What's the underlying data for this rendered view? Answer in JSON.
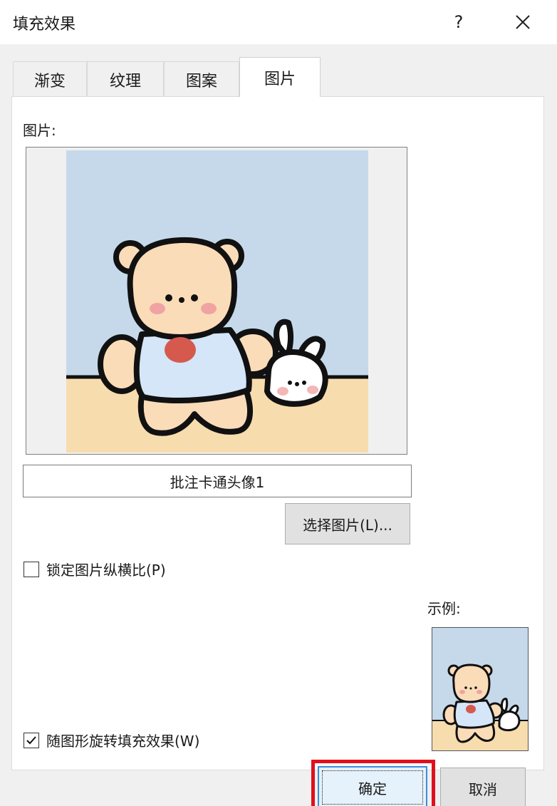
{
  "dialog": {
    "title": "填充效果",
    "help_label": "?"
  },
  "tabs": [
    {
      "label": "渐变"
    },
    {
      "label": "纹理"
    },
    {
      "label": "图案"
    },
    {
      "label": "图片",
      "active": true
    }
  ],
  "picture_panel": {
    "label": "图片:",
    "picture_name": "批注卡通头像1",
    "choose_button": "选择图片(L)...",
    "lock_aspect": {
      "label": "锁定图片纵横比(P)",
      "checked": false
    },
    "sample_label": "示例:",
    "rotate_with_shape": {
      "label": "随图形旋转填充效果(W)",
      "checked": true
    }
  },
  "footer": {
    "ok_label": "确定",
    "cancel_label": "取消"
  },
  "colors": {
    "highlight": "#e0101c",
    "sky": "#c5d9eb",
    "floor": "#f7dcae",
    "bear": "#fbdcb8",
    "shirt": "#d4e6f7",
    "heart": "#d6594e"
  }
}
